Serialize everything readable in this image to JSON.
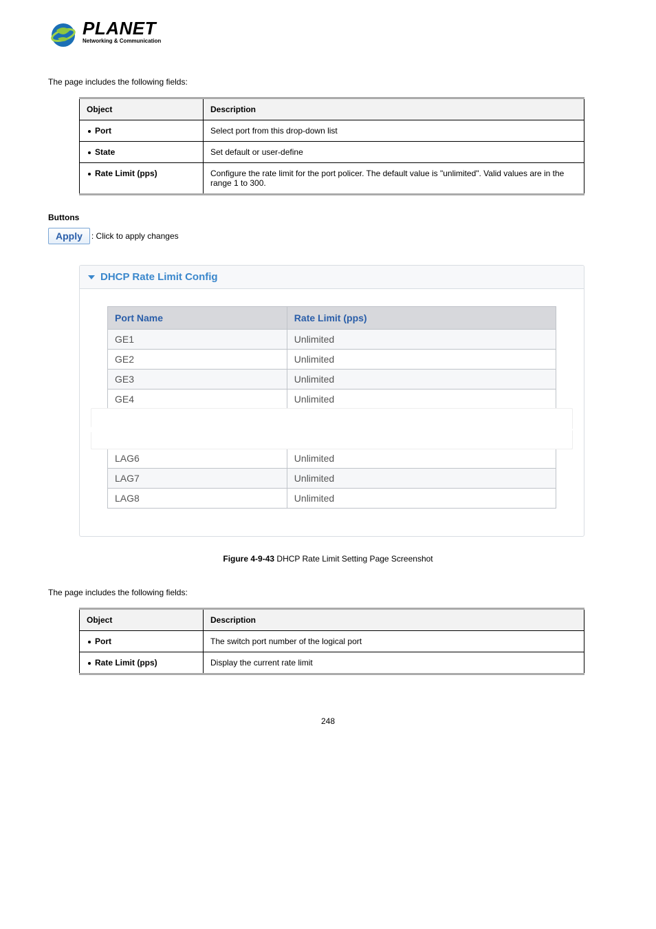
{
  "logo": {
    "name": "PLANET",
    "tagline": "Networking & Communication"
  },
  "intro1": "The page includes the following fields:",
  "table1": {
    "h_obj": "Object",
    "h_desc": "Description",
    "rows": [
      {
        "name": "Port",
        "desc": "Select port from this drop-down list"
      },
      {
        "name": "State",
        "desc": "Set default or user-define"
      },
      {
        "name": "Rate Limit (pps)",
        "desc": "Configure the rate limit for the port policer. The default value is \"unlimited\". Valid values are in the range 1 to 300."
      }
    ]
  },
  "buttons_heading": "Buttons",
  "apply": {
    "label": "Apply",
    "desc": ": Click to apply changes"
  },
  "config": {
    "title": "DHCP Rate Limit Config",
    "h_port": "Port Name",
    "h_rate": "Rate Limit (pps)",
    "top_rows": [
      {
        "port": "GE1",
        "rate": "Unlimited"
      },
      {
        "port": "GE2",
        "rate": "Unlimited"
      },
      {
        "port": "GE3",
        "rate": "Unlimited"
      },
      {
        "port": "GE4",
        "rate": "Unlimited"
      }
    ],
    "bot_rows": [
      {
        "port": "LAG6",
        "rate": "Unlimited"
      },
      {
        "port": "LAG7",
        "rate": "Unlimited"
      },
      {
        "port": "LAG8",
        "rate": "Unlimited"
      }
    ]
  },
  "figure": {
    "bold": "Figure 4-9-43",
    "rest": " DHCP Rate Limit Setting Page Screenshot"
  },
  "intro2": "The page includes the following fields:",
  "table2": {
    "h_obj": "Object",
    "h_desc": "Description",
    "rows": [
      {
        "name": "Port",
        "desc": "The switch port number of the logical port"
      },
      {
        "name": "Rate Limit (pps)",
        "desc": "Display the current rate limit"
      }
    ]
  },
  "page_num": "248"
}
